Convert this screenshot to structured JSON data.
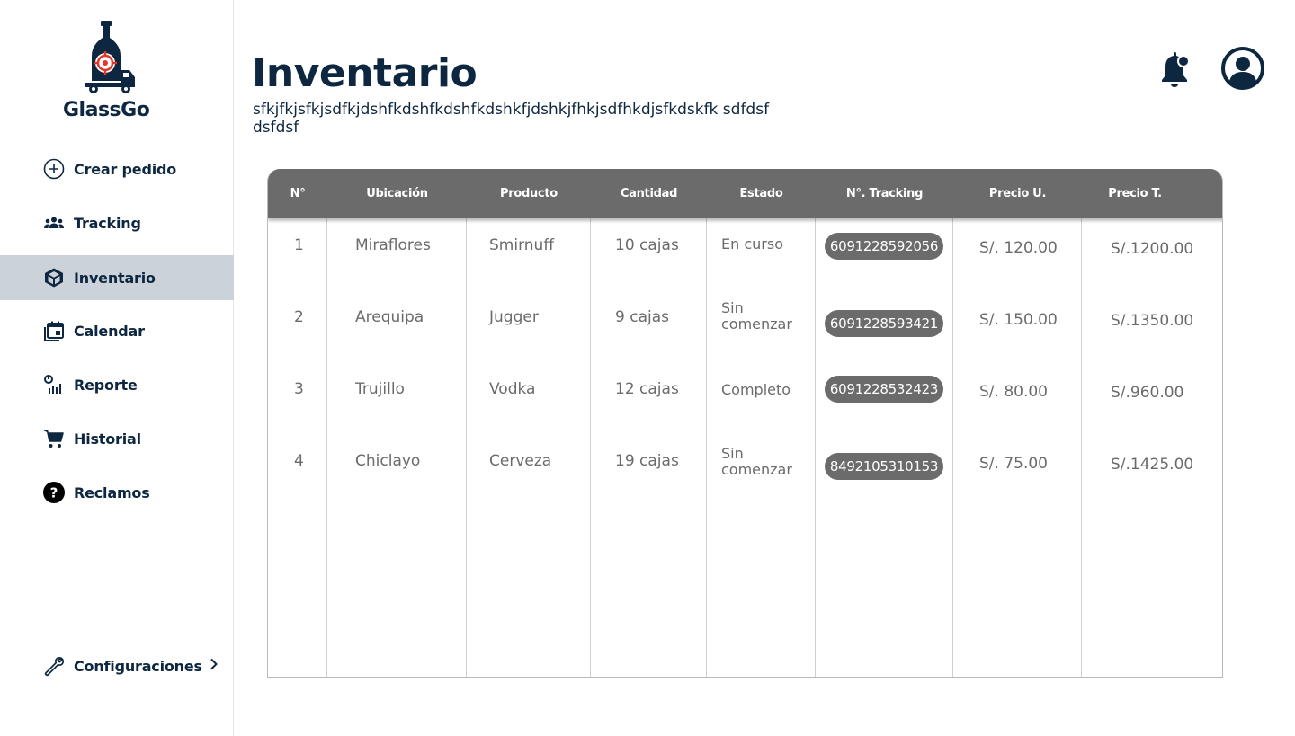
{
  "app": {
    "name": "GlassGo"
  },
  "sidebar": {
    "items": [
      {
        "label": "Crear pedido",
        "icon": "plus-circle-icon"
      },
      {
        "label": "Tracking",
        "icon": "users-icon"
      },
      {
        "label": "Inventario",
        "icon": "cube-icon",
        "active": true
      },
      {
        "label": "Calendar",
        "icon": "calendar-icon"
      },
      {
        "label": "Reporte",
        "icon": "report-icon"
      },
      {
        "label": "Historial",
        "icon": "cart-icon"
      },
      {
        "label": "Reclamos",
        "icon": "help-icon"
      }
    ],
    "config_label": "Configuraciones"
  },
  "header": {
    "title": "Inventario",
    "subtitle": "sfkjfkjsfkjsdfkjdshfkdshfkdshfkdshkfjdshkjfhkjsdfhkdjsfkdskfk sdfdsfdsfdsf"
  },
  "table": {
    "columns": [
      "N°",
      "Ubicación",
      "Producto",
      "Cantidad",
      "Estado",
      "N°. Tracking",
      "Precio U.",
      "Precio T."
    ],
    "rows": [
      {
        "n": "1",
        "ubicacion": "Miraflores",
        "producto": "Smirnuff",
        "cantidad": "10 cajas",
        "estado": "En curso",
        "tracking": "6091228592056",
        "precio_u": "S/. 120.00",
        "precio_t": "S/.1200.00"
      },
      {
        "n": "2",
        "ubicacion": "Arequipa",
        "producto": "Jugger",
        "cantidad": "9 cajas",
        "estado": "Sin comenzar",
        "tracking": "6091228593421",
        "precio_u": "S/. 150.00",
        "precio_t": "S/.1350.00"
      },
      {
        "n": "3",
        "ubicacion": "Trujillo",
        "producto": "Vodka",
        "cantidad": "12 cajas",
        "estado": "Completo",
        "tracking": "6091228532423",
        "precio_u": "S/. 80.00",
        "precio_t": "S/.960.00"
      },
      {
        "n": "4",
        "ubicacion": "Chiclayo",
        "producto": "Cerveza",
        "cantidad": "19 cajas",
        "estado": "Sin comenzar",
        "tracking": "8492105310153",
        "precio_u": "S/. 75.00",
        "precio_t": "S/.1425.00"
      }
    ]
  },
  "colors": {
    "primary": "#0e2740",
    "active_bg": "#cbd2da",
    "header_bg": "#6b6b6b",
    "logo_accent": "#e0392b"
  }
}
